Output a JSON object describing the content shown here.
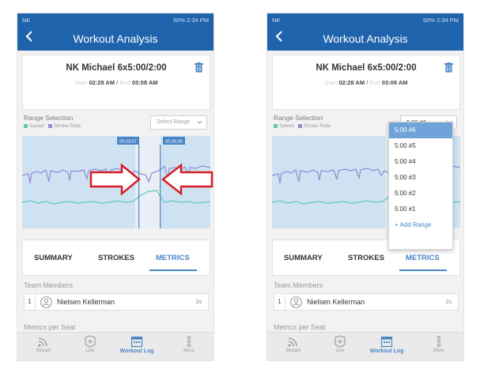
{
  "colors": {
    "app_bar": "#2063ad",
    "accent": "#4a86c6",
    "speed_series": "#5ec9b6",
    "stroke_rate_series": "#8e8ed6",
    "chart_background": "#d2e4f3",
    "callout_arrows": "#d61f26"
  },
  "status_bar": {
    "carrier": "NK",
    "time": "2:34 PM",
    "battery": "50%"
  },
  "app_bar": {
    "title": "Workout Analysis",
    "back_icon": "chevron-left-icon"
  },
  "workout": {
    "title": "NK Michael 6x5:00/2:00",
    "start_label": "Start",
    "start_time": "02:28 AM",
    "separator": "/",
    "end_label": "End",
    "end_time": "03:08 AM",
    "delete_icon": "trash-icon"
  },
  "range_selection": {
    "label": "Range Selection",
    "legend": [
      {
        "name": "Speed",
        "color": "#5ec9b6"
      },
      {
        "name": "Stroke Rate",
        "color": "#8e8ed6"
      }
    ],
    "placeholder": "Select Range",
    "selected": "5:00 #6"
  },
  "chart": {
    "markers": [
      "00:23:57",
      "00:36:30"
    ]
  },
  "tabs": [
    {
      "label": "SUMMARY"
    },
    {
      "label": "STROKES"
    },
    {
      "label": "METRICS"
    }
  ],
  "active_tab": "METRICS",
  "team": {
    "label": "Team Members",
    "members": [
      {
        "seat": "1",
        "name": "Nielsen Kellerman",
        "badge": "2s"
      }
    ]
  },
  "metrics_per_seat_label": "Metrics per Seat",
  "range_dropdown": {
    "items": [
      "5:00 #6",
      "5:00 #5",
      "5:00 #4",
      "5:00 #3",
      "5:00 #2",
      "5:00 #1"
    ],
    "add_label": "+ Add Range"
  },
  "bottom_nav": [
    {
      "label": "Stream",
      "icon": "stream-icon"
    },
    {
      "label": "Live",
      "icon": "live-icon"
    },
    {
      "label": "Workout Log",
      "icon": "calendar-icon"
    },
    {
      "label": "More",
      "icon": "more-icon"
    }
  ]
}
